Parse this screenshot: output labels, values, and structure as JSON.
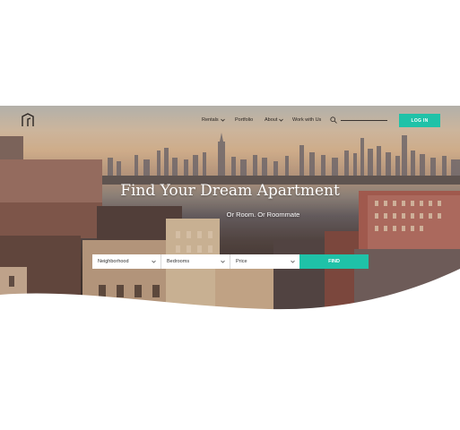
{
  "brand": {
    "logo_icon": "house-door-icon"
  },
  "nav": {
    "items": [
      {
        "label": "Rentals",
        "has_dropdown": true
      },
      {
        "label": "Portfolio",
        "has_dropdown": false
      },
      {
        "label": "About",
        "has_dropdown": true
      },
      {
        "label": "Work with Us",
        "has_dropdown": false
      }
    ],
    "search_icon": "search-icon",
    "login_label": "LOG IN"
  },
  "hero": {
    "title": "Find Your Dream Apartment",
    "subtitle": "Or Room. Or Roommate"
  },
  "search": {
    "neighborhood": "Neighborhood",
    "bedrooms": "Bedrooms",
    "price": "Price",
    "find_label": "FIND"
  },
  "colors": {
    "accent": "#1fc2a8",
    "text_dark": "#2a2522",
    "background": "#ffffff"
  }
}
